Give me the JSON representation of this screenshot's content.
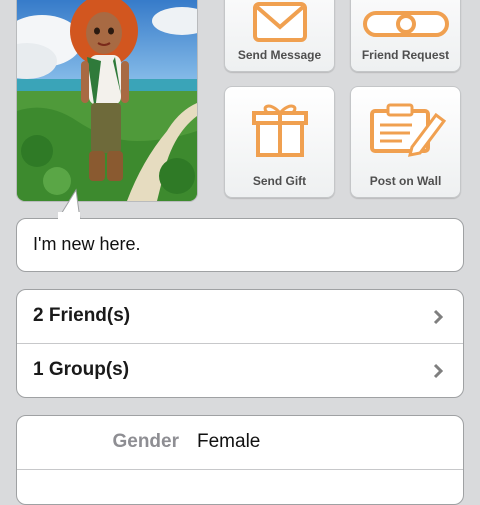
{
  "actions": {
    "send_message": "Send Message",
    "friend_request": "Friend Request",
    "send_gift": "Send Gift",
    "post_on_wall": "Post on Wall"
  },
  "status_message": "I'm new here.",
  "counts": {
    "friends": "2 Friend(s)",
    "groups": "1 Group(s)"
  },
  "info": {
    "gender_label": "Gender",
    "gender_value": "Female"
  },
  "colors": {
    "accent_orange": "#f0a050",
    "background": "#d9dadc"
  },
  "icons": {
    "send_message": "envelope-icon",
    "friend_request": "bone-friendship-icon",
    "send_gift": "gift-box-icon",
    "post_on_wall": "notepad-pencil-icon",
    "disclosure": "chevron-right-icon"
  }
}
